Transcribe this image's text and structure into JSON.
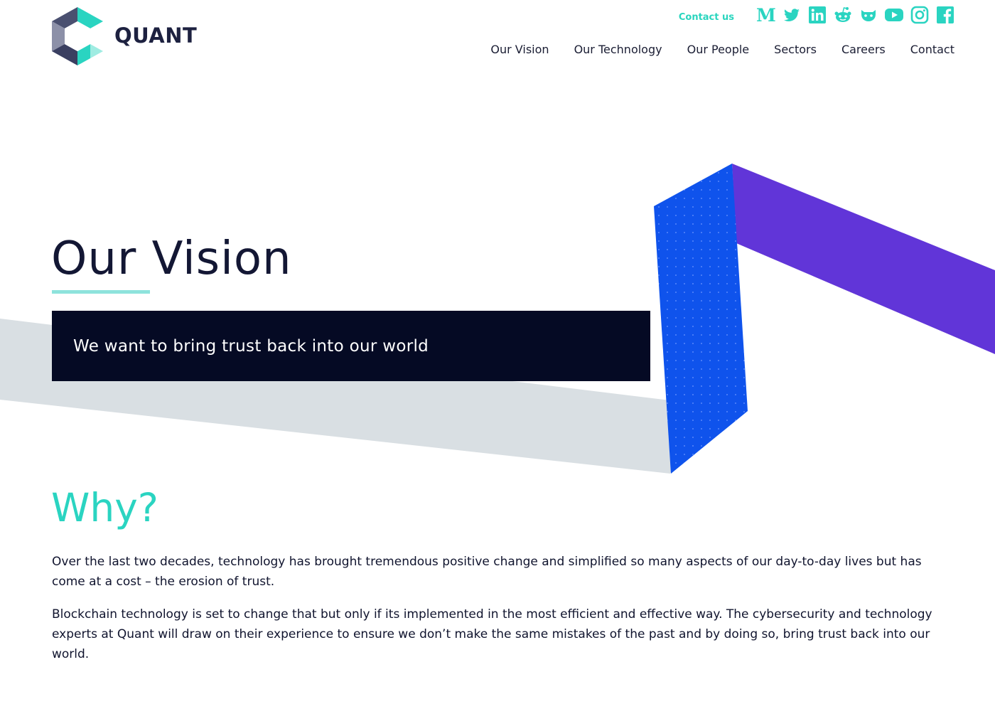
{
  "brand": {
    "name": "QUANT",
    "colors": {
      "teal": "#2ad4c1",
      "navy": "#050a24",
      "blue": "#0f53ec",
      "purple": "#6135d8",
      "light_gray": "#d9dfe3"
    }
  },
  "header": {
    "contact_link": "Contact us",
    "social_icons": [
      "medium-icon",
      "twitter-icon",
      "linkedin-icon",
      "reddit-icon",
      "github-icon",
      "youtube-icon",
      "instagram-icon",
      "facebook-icon"
    ],
    "nav": [
      "Our Vision",
      "Our Technology",
      "Our People",
      "Sectors",
      "Careers",
      "Contact"
    ]
  },
  "hero": {
    "title": "Our Vision",
    "banner_text": "We want to bring trust back into our world"
  },
  "why": {
    "heading": "Why?",
    "paragraphs": [
      "Over the last two decades, technology has brought tremendous positive change and simplified so many aspects of our day-to-day lives but has come at a cost – the erosion of trust.",
      "Blockchain technology is set to change that but only if its implemented in the most efficient and effective way. The cybersecurity and technology experts at Quant will draw on their experience to ensure we don’t make the same mistakes of the past and by doing so, bring trust back into our world."
    ]
  }
}
